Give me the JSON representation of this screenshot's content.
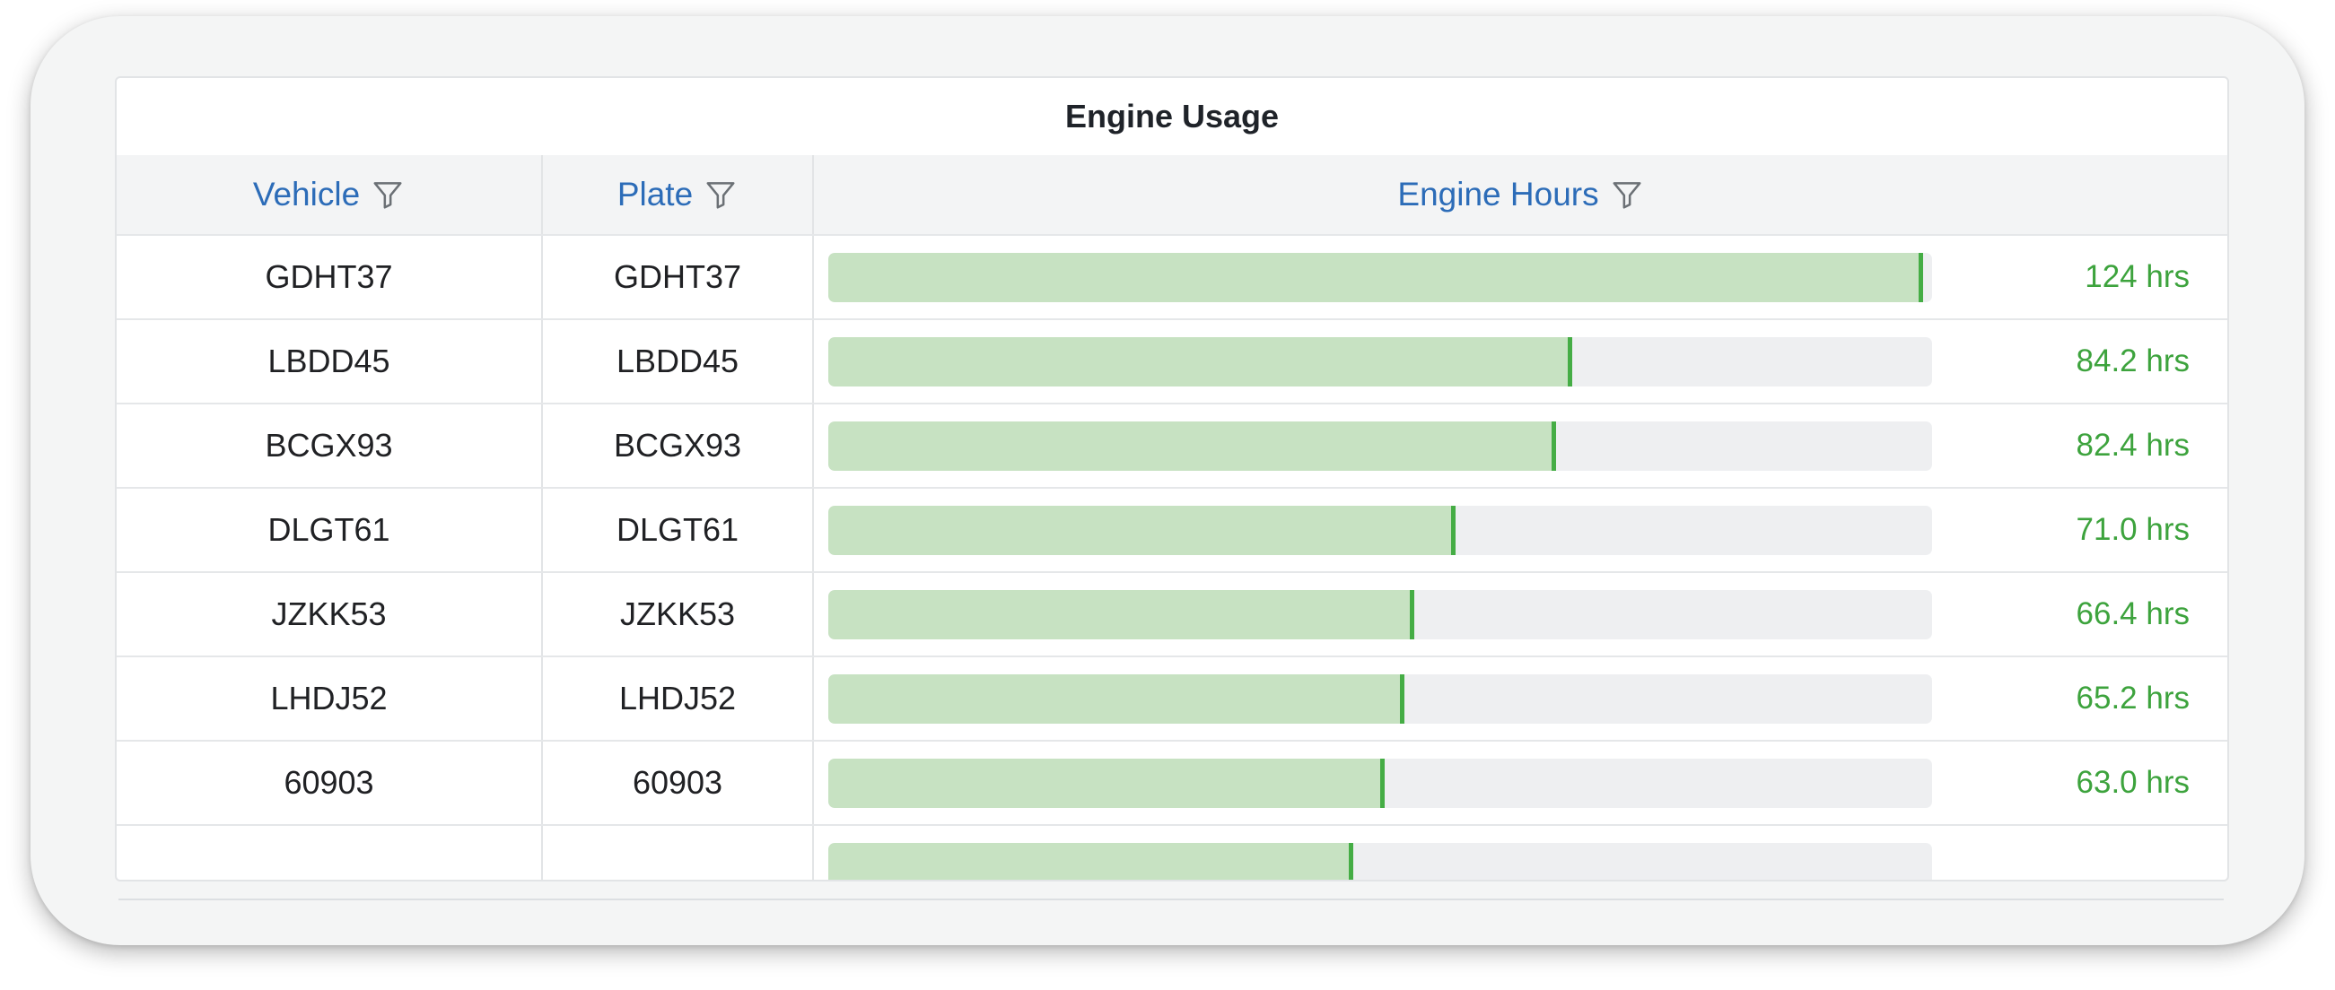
{
  "widget": {
    "title": "Engine Usage"
  },
  "columns": {
    "vehicle": "Vehicle",
    "plate": "Plate",
    "engine_hours": "Engine Hours"
  },
  "icons": {
    "filter": "filter-icon"
  },
  "colors": {
    "header_text": "#2c6cb8",
    "bar_fill": "#c7e2c2",
    "bar_marker": "#45ad45",
    "bar_track": "#eeeff1",
    "value_text": "#3da33d"
  },
  "bar_scale_max": 125,
  "rows": [
    {
      "vehicle": "GDHT37",
      "plate": "GDHT37",
      "hours": 124,
      "hours_label": "124 hrs"
    },
    {
      "vehicle": "LBDD45",
      "plate": "LBDD45",
      "hours": 84.2,
      "hours_label": "84.2 hrs"
    },
    {
      "vehicle": "BCGX93",
      "plate": "BCGX93",
      "hours": 82.4,
      "hours_label": "82.4 hrs"
    },
    {
      "vehicle": "DLGT61",
      "plate": "DLGT61",
      "hours": 71.0,
      "hours_label": "71.0 hrs"
    },
    {
      "vehicle": "JZKK53",
      "plate": "JZKK53",
      "hours": 66.4,
      "hours_label": "66.4 hrs"
    },
    {
      "vehicle": "LHDJ52",
      "plate": "LHDJ52",
      "hours": 65.2,
      "hours_label": "65.2 hrs"
    },
    {
      "vehicle": "60903",
      "plate": "60903",
      "hours": 63.0,
      "hours_label": "63.0 hrs"
    },
    {
      "vehicle": "",
      "plate": "",
      "hours": 59.5,
      "hours_label": ""
    }
  ]
}
